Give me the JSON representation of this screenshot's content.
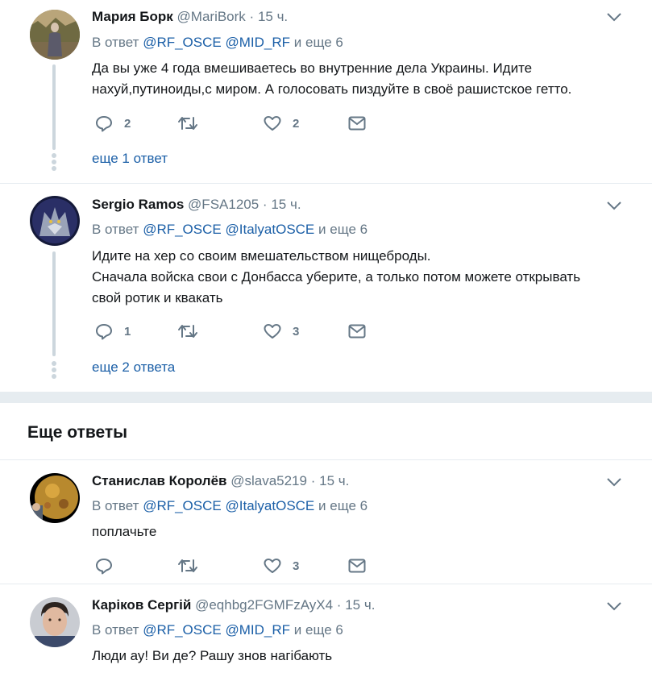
{
  "tweets": [
    {
      "name": "Мария Борк",
      "handle": "@MariBork",
      "sep": "·",
      "time": "15 ч.",
      "reply_prefix": "В ответ",
      "mention1": "@RF_OSCE",
      "mention2": "@MID_RF",
      "reply_suffix": "и еще 6",
      "lines": [
        "Да вы уже 4 года вмешиваетесь во внутренние дела Украины. Идите",
        "нахуй,путиноиды,с миром. А голосовать пиздуйте в своё рашистское гетто."
      ],
      "replies": "2",
      "retweets": "",
      "likes": "2",
      "more": "еще 1 ответ"
    },
    {
      "name": "Sergio Ramos",
      "handle": "@FSA1205",
      "sep": "·",
      "time": "15 ч.",
      "reply_prefix": "В ответ",
      "mention1": "@RF_OSCE",
      "mention2": "@ItalyatOSCE",
      "reply_suffix": "и еще 6",
      "lines": [
        "Идите на хер со своим вмешательством нищеброды.",
        "Сначала войска свои с Донбасса уберите, а только потом можете открывать",
        "свой ротик и квакать"
      ],
      "replies": "1",
      "retweets": "",
      "likes": "3",
      "more": "еще 2 ответа"
    },
    {
      "name": "Станислав Королёв",
      "handle": "@slava5219",
      "sep": "·",
      "time": "15 ч.",
      "reply_prefix": "В ответ",
      "mention1": "@RF_OSCE",
      "mention2": "@ItalyatOSCE",
      "reply_suffix": "и еще 6",
      "lines": [
        "поплачьте"
      ],
      "replies": "",
      "retweets": "",
      "likes": "3"
    },
    {
      "name": "Каріков Сергій",
      "handle": "@eqhbg2FGMFzAyX4",
      "sep": "·",
      "time": "15 ч.",
      "reply_prefix": "В ответ",
      "mention1": "@RF_OSCE",
      "mention2": "@MID_RF",
      "reply_suffix": "и еще 6",
      "lines": [
        "Люди ау! Ви де? Рашу знов нагібають"
      ]
    }
  ],
  "section_title": "Еще ответы",
  "icons": {
    "reply": "reply-icon",
    "retweet": "retweet-icon",
    "like": "heart-icon",
    "dm": "envelope-icon",
    "caret": "chevron-down-icon"
  },
  "colors": {
    "link": "#1b5fa7",
    "muted": "#657786",
    "text": "#14171a",
    "border": "#e6ecf0",
    "thread": "#ccd6dd"
  }
}
